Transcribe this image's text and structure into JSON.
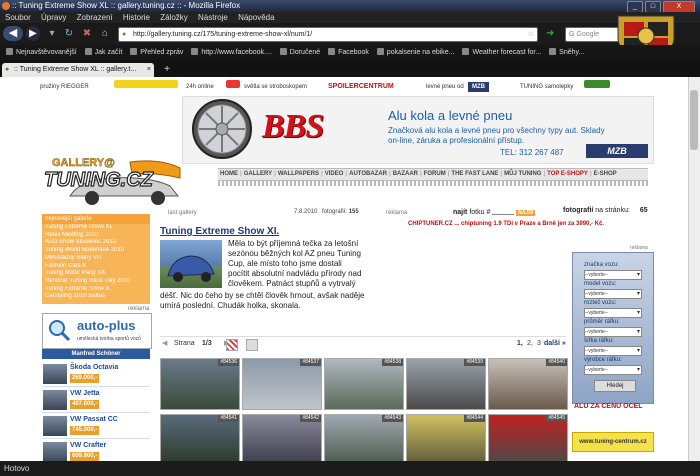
{
  "window": {
    "title": ":: Tuning Extreme Show XL :: gallery.tuning.cz :: - Mozilla Firefox",
    "minimize": "_",
    "maximize": "□",
    "close": "X"
  },
  "menu": [
    "Soubor",
    "Úpravy",
    "Zobrazení",
    "Historie",
    "Záložky",
    "Nástroje",
    "Nápověda"
  ],
  "nav": {
    "url": "http://gallery.tuning.cz/175/tuning-extreme-show-xl/num/1/",
    "search_placeholder": "Google"
  },
  "bookmarks": [
    "Nejnavštěvovanější",
    "Jak začít",
    "Přehled zpráv",
    "http://www.facebook....",
    "Doručené",
    "Facebook",
    "pokalsenie na ebike...",
    "Weather forecast for...",
    "Sněhy..."
  ],
  "tab": {
    "label": ":: Tuning Extreme Show XL :: gallery.t...",
    "close": "×",
    "new": "+"
  },
  "sponsors": [
    "pružiny RIEGGER",
    "24h online",
    "světla se stroboskopem",
    "SPOILERCENTRUM",
    "levné pneu od",
    "MZB",
    "TUNING samolepky"
  ],
  "banner": {
    "brand": "BBS",
    "title": "Alu kola a levné pneu",
    "text": "Značková alu kola a levné pneu pro všechny typy aut. Sklady on-line, záruka a profesionální přístup.",
    "tel": "TEL: 312 267 487",
    "mzb": "MZB"
  },
  "logo": {
    "top": "GALLERY@",
    "main": "TUNING.CZ"
  },
  "sitenav": [
    {
      "label": "HOME",
      "active": false
    },
    {
      "label": "GALLERY",
      "active": false
    },
    {
      "label": "WALLPAPERS",
      "active": false
    },
    {
      "label": "VIDEO",
      "active": false
    },
    {
      "label": "AUTOBAZAR",
      "active": false
    },
    {
      "label": "BAZAAR",
      "active": false
    },
    {
      "label": "FORUM",
      "active": false
    },
    {
      "label": "THE FAST LANE",
      "active": false
    },
    {
      "label": "MŮJ TUNING",
      "active": false
    },
    {
      "label": "TOP E-SHOPY",
      "active": true
    },
    {
      "label": "E-SHOP",
      "active": false
    }
  ],
  "gallery_header": {
    "last_label": "last gallery",
    "date": "7.8.2010",
    "photos_label": "fotografií:",
    "photos_count": "155",
    "find_label": "najít",
    "find_photo": "fotku #",
    "find_btn": "NAJDI",
    "per_page_label": "fotografií",
    "per_page_suffix": "na stránku:",
    "per_page": "65",
    "reklama": "reklama"
  },
  "chiptuner": "CHIPTUNER.CZ ... chiptuning 1.9 TDi v Praze a Brně jen za 3990,- Kč.",
  "sidebar": {
    "head": "nejnovější galerie",
    "items": [
      "Tuning Extreme Show XL",
      "Relax Meeting 2010",
      "Auto Show Studenec 2010",
      "Tuning World Bodensee 2010",
      "Mimořádný Slaný VIT",
      "Fashion Cars 8",
      "Tuning Motor Party XII.",
      "Renocar Tuning Race Day 2010",
      "Tuning Extreme Show X.",
      "Carstyling 2010 Baltes"
    ],
    "reklama": "reklama",
    "autoplus": "auto-plus",
    "autoplus_sub": "umělecká tvorba sportů vozů",
    "schoner": "Manfred Schöner",
    "cars": [
      {
        "name": "Škoda Octavia",
        "price": "269.000,-"
      },
      {
        "name": "VW Jetta",
        "price": "407.000,-"
      },
      {
        "name": "VW Passat CC",
        "price": "745.000,-"
      },
      {
        "name": "VW Crafter",
        "price": "609.900,-"
      }
    ]
  },
  "gallery": {
    "title": "Tuning Extreme Show XI.",
    "text1": "Měla to být příjemná tečka za letošní sezónou běžných kol AZ pneu Tuning Cup, ale místo toho jsme dostali pocítit absolutní nadvládu přírody nad člověkem. Patnáct stupňů a vytrvalý",
    "text2": "déšť. Nic do čeho by se chtěl člověk hrnout, avšak naděje umírá poslední. Chudák holka, skonala.",
    "pager_label": "Strana",
    "pager_value": "1/3",
    "pages": [
      "1,",
      "2,",
      "3"
    ],
    "next": "další »",
    "thumbs": [
      "#84536",
      "#84537",
      "#84538",
      "#84539",
      "#84540",
      "#84541",
      "#84542",
      "#84543",
      "#84544",
      "#84545"
    ]
  },
  "filter": {
    "reklama": "reklama",
    "labels": [
      "značka vozu:",
      "model vozu:",
      "rozteč vozu:",
      "průměr ráfku:",
      "šířka ráfku:",
      "výrobce ráfku:"
    ],
    "placeholder": "--vyberte--",
    "button": "Hledej",
    "alu": "ALU ZA CENU OCEL",
    "tcentrum": "www.tuning-centrum.cz"
  },
  "status": "Hotovo"
}
